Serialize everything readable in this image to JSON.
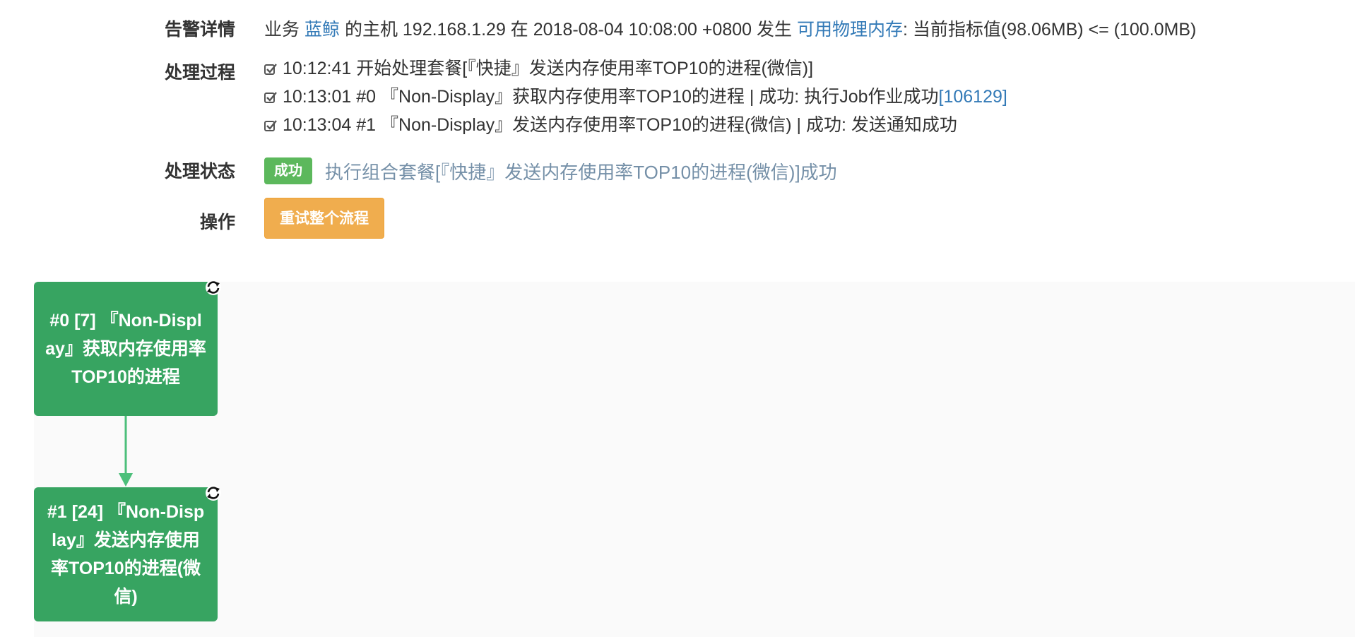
{
  "alert_detail": {
    "label": "告警详情",
    "prefix": "业务",
    "business_name": "蓝鲸",
    "host_text": "的主机 192.168.1.29 在 2018-08-04 10:08:00 +0800 发生",
    "metric_name": "可用物理内存",
    "condition_text": ": 当前指标值(98.06MB) <= (100.0MB)"
  },
  "process": {
    "label": "处理过程",
    "steps": [
      {
        "text": "10:12:41 开始处理套餐[『快捷』发送内存使用率TOP10的进程(微信)]",
        "link": ""
      },
      {
        "text": "10:13:01 #0 『Non-Display』获取内存使用率TOP10的进程 | 成功: 执行Job作业成功",
        "link": "[106129]"
      },
      {
        "text": "10:13:04 #1 『Non-Display』发送内存使用率TOP10的进程(微信) | 成功: 发送通知成功",
        "link": ""
      }
    ],
    "check_icon": "check-square-icon"
  },
  "status": {
    "label": "处理状态",
    "badge": "成功",
    "text": "执行组合套餐[『快捷』发送内存使用率TOP10的进程(微信)]成功",
    "badge_color": "#5cb85c"
  },
  "operation": {
    "label": "操作",
    "retry_label": "重试整个流程",
    "retry_color": "#f0ad4e"
  },
  "flow": {
    "nodes": [
      {
        "text": "#0 [7] 『Non-Display』获取内存使用率TOP10的进程",
        "icon": "refresh-icon"
      },
      {
        "text": "#1 [24] 『Non-Display』发送内存使用率TOP10的进程(微信)",
        "icon": "refresh-icon"
      }
    ],
    "node_color": "#37a461",
    "connector_color": "#4cbf7a"
  }
}
